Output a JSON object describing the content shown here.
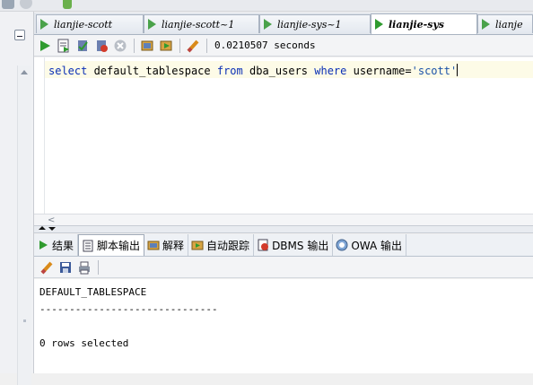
{
  "editor_tabs": [
    {
      "label": "lianjie-scott",
      "active": false
    },
    {
      "label": "lianjie-scott~1",
      "active": false
    },
    {
      "label": "lianjie-sys~1",
      "active": false
    },
    {
      "label": "lianjie-sys",
      "active": true
    },
    {
      "label": "lianje",
      "active": false
    }
  ],
  "toolbar": {
    "timing": "0.0210507 seconds",
    "icons": [
      "run-statement-icon",
      "run-script-icon",
      "commit-icon",
      "rollback-icon",
      "cancel-icon",
      "sql-tuning-icon",
      "unshared-sql-icon",
      "clear-icon"
    ]
  },
  "editor": {
    "sql_tokens": [
      {
        "text": "select",
        "kind": "kw"
      },
      {
        "text": " default_tablespace ",
        "kind": "plain"
      },
      {
        "text": "from",
        "kind": "kw"
      },
      {
        "text": " dba_users ",
        "kind": "plain"
      },
      {
        "text": "where",
        "kind": "kw"
      },
      {
        "text": " username=",
        "kind": "plain"
      },
      {
        "text": "'scott'",
        "kind": "str"
      }
    ]
  },
  "result_tabs": [
    {
      "label": "结果",
      "icon": "play-icon",
      "active": false
    },
    {
      "label": "脚本输出",
      "icon": "script-output-icon",
      "active": true
    },
    {
      "label": "解释",
      "icon": "explain-icon",
      "active": false
    },
    {
      "label": "自动跟踪",
      "icon": "autotrace-icon",
      "active": false
    },
    {
      "label": "DBMS 输出",
      "icon": "dbms-output-icon",
      "active": false
    },
    {
      "label": "OWA 输出",
      "icon": "owa-output-icon",
      "active": false
    }
  ],
  "output": {
    "lines": [
      "DEFAULT_TABLESPACE",
      "------------------------------",
      "",
      "0 rows selected"
    ]
  },
  "colors": {
    "keyword": "#0a2fb5",
    "string": "#1c53a8",
    "play_green": "#2f9b2f"
  }
}
